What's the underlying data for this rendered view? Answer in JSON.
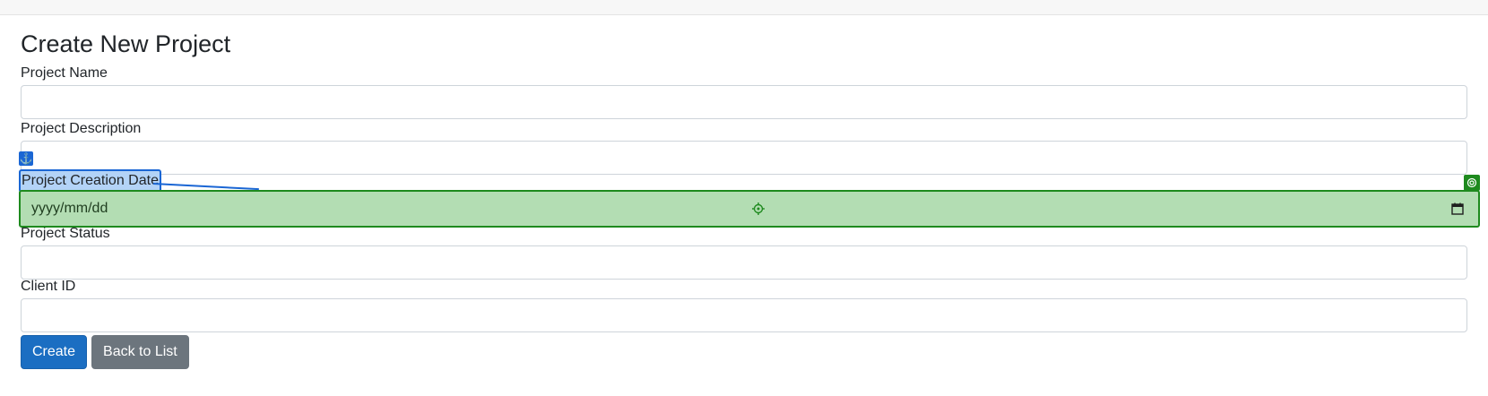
{
  "page": {
    "title": "Create New Project"
  },
  "form": {
    "project_name": {
      "label": "Project Name",
      "value": ""
    },
    "project_description": {
      "label": "Project Description",
      "value": ""
    },
    "project_creation_date": {
      "label": "Project Creation Date",
      "placeholder": "yyyy/mm/dd"
    },
    "project_status": {
      "label": "Project Status",
      "value": ""
    },
    "client_id": {
      "label": "Client ID",
      "value": ""
    }
  },
  "buttons": {
    "create": "Create",
    "back": "Back to List"
  },
  "overlay": {
    "anchor_icon": "⚓",
    "anchor_color": "#1a66d4",
    "target_color": "#1e8a1e",
    "highlight_label_bg": "#b3d3f7",
    "highlight_field_bg": "#b3ddb3"
  }
}
